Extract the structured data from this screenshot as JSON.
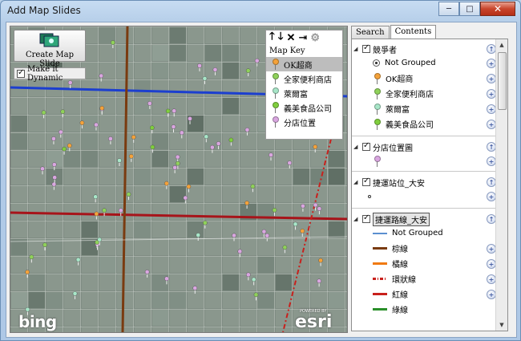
{
  "window": {
    "title": "Add Map Slides",
    "min": "─",
    "max": "□",
    "close": "✕"
  },
  "map": {
    "create_label": "Create Map Slide",
    "dynamic_label": "Make it Dynamic",
    "map_key_title": "Map Key",
    "key_items": [
      {
        "label": "OK超商",
        "color": "#f4a23a"
      },
      {
        "label": "全家便利商店",
        "color": "#8fd15a"
      },
      {
        "label": "萊爾富",
        "color": "#a8e6c8"
      },
      {
        "label": "義美食品公司",
        "color": "#7fce3d"
      },
      {
        "label": "分店位置",
        "color": "#d9a6e0"
      }
    ],
    "bing_logo": "bing",
    "esri_powered": "POWERED BY",
    "esri_logo": "esri"
  },
  "tabs": {
    "search": "Search",
    "contents": "Contents"
  },
  "contents": {
    "group1": {
      "label": "競爭者",
      "not_grouped": "Not Grouped",
      "items": [
        {
          "label": "OK超商",
          "color": "#f4a23a"
        },
        {
          "label": "全家便利商店",
          "color": "#8fd15a"
        },
        {
          "label": "萊爾富",
          "color": "#a8e6c8"
        },
        {
          "label": "義美食品公司",
          "color": "#7fce3d"
        }
      ]
    },
    "group2": {
      "label": "分店位置圖",
      "pin_color": "#d9a6e0"
    },
    "group3": {
      "label": "捷運站位_大安"
    },
    "group4": {
      "label": "捷運路線_大安",
      "not_grouped": "Not Grouped",
      "items": [
        {
          "label": "棕線",
          "color": "#7a3b10",
          "style": "solid"
        },
        {
          "label": "橘線",
          "color": "#f07a12",
          "style": "solid"
        },
        {
          "label": "環狀線",
          "color": "#c8201c",
          "style": "dash"
        },
        {
          "label": "紅線",
          "color": "#c8201c",
          "style": "solid"
        },
        {
          "label": "綠線",
          "color": "#2a8f2a",
          "style": "solid"
        }
      ]
    },
    "add_icon": "+"
  }
}
